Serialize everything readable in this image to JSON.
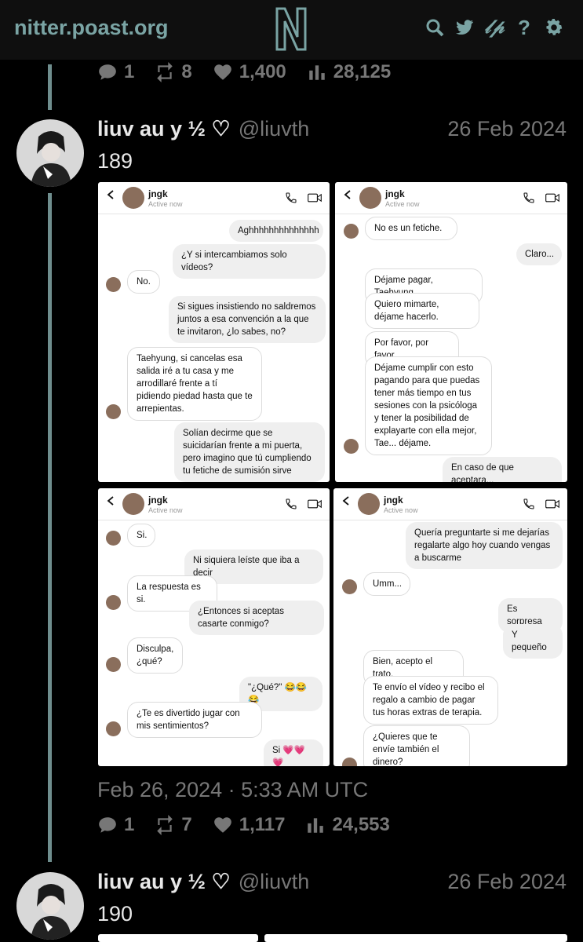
{
  "header": {
    "site": "nitter.poast.org"
  },
  "top_stats": {
    "replies": "1",
    "retweets": "8",
    "likes": "1,400",
    "views": "28,125"
  },
  "tweets": [
    {
      "name": "liuv au y ½ ♡",
      "handle": "@liuvth",
      "date": "26 Feb 2024",
      "text": "189",
      "timestamp": "Feb 26, 2024 · 5:33 AM UTC",
      "stats": {
        "replies": "1",
        "retweets": "7",
        "likes": "1,117",
        "views": "24,553"
      }
    },
    {
      "name": "liuv au y ½ ♡",
      "handle": "@liuvth",
      "date": "26 Feb 2024",
      "text": "190"
    }
  ],
  "chat_header": {
    "name": "jngk",
    "status": "Active now"
  },
  "shots": [
    {
      "messages": [
        {
          "text": "Aghhhhhhhhhhhhhh",
          "dir": "sent"
        },
        {
          "text": "¿Y si intercambiamos solo vídeos?",
          "dir": "sent"
        },
        {
          "text": "No.",
          "dir": "recv"
        },
        {
          "text": "Si sigues insistiendo no saldremos juntos a esa convención a la que te invitaron, ¿lo sabes, no?",
          "dir": "sent"
        },
        {
          "text": "Taehyung, si cancelas esa salida iré a tu casa y me arrodillaré frente a tí pidiendo piedad hasta que te arrepientas.",
          "dir": "recv"
        },
        {
          "text": "Solían decirme que se suicidarían frente a mi puerta, pero imagino que tú cumpliendo tu fetiche de sumisión sirve",
          "dir": "sent"
        }
      ]
    },
    {
      "messages": [
        {
          "text": "No es un fetiche.",
          "dir": "recv"
        },
        {
          "text": "Claro...",
          "dir": "sent"
        },
        {
          "text": "Déjame pagar, Taehyung.",
          "dir": "recv"
        },
        {
          "text": "Quiero mimarte, déjame hacerlo.",
          "dir": "recv"
        },
        {
          "text": "Por favor, por favor.",
          "dir": "recv"
        },
        {
          "text": "Déjame cumplir con esto pagando para que puedas tener más tiempo en tus sesiones con la psicóloga y tener la posibilidad de explayarte con ella mejor, Tae... déjame.",
          "dir": "recv"
        },
        {
          "text": "En caso de que aceptara...",
          "dir": "sent"
        }
      ]
    },
    {
      "messages": [
        {
          "text": "Si.",
          "dir": "recv"
        },
        {
          "text": "Ni siquiera leíste que iba a decir",
          "dir": "sent"
        },
        {
          "text": "La respuesta es si.",
          "dir": "recv"
        },
        {
          "text": "¿Entonces si aceptas casarte conmigo?",
          "dir": "sent"
        },
        {
          "text": "Disculpa, ¿qué?",
          "dir": "recv"
        },
        {
          "text": "\"¿Qué?\" 😂😂😂",
          "dir": "sent"
        },
        {
          "text": "¿Te es divertido jugar con mis sentimientos?",
          "dir": "recv"
        },
        {
          "text": "Si 💗💗💗",
          "dir": "sent"
        }
      ]
    },
    {
      "messages": [
        {
          "text": "Quería preguntarte si me dejarías regalarte algo hoy cuando vengas a buscarme",
          "dir": "sent"
        },
        {
          "text": "Umm...",
          "dir": "recv"
        },
        {
          "text": "Es sorpresa",
          "dir": "sent"
        },
        {
          "text": "Y pequeño",
          "dir": "sent"
        },
        {
          "text": "Bien, acepto el trato.",
          "dir": "recv"
        },
        {
          "text": "Te envío el vídeo y recibo el regalo a cambio de pagar tus horas extras de terapia.",
          "dir": "recv"
        },
        {
          "text": "¿Quieres que te envíe también el dinero?",
          "dir": "recv"
        }
      ]
    }
  ]
}
